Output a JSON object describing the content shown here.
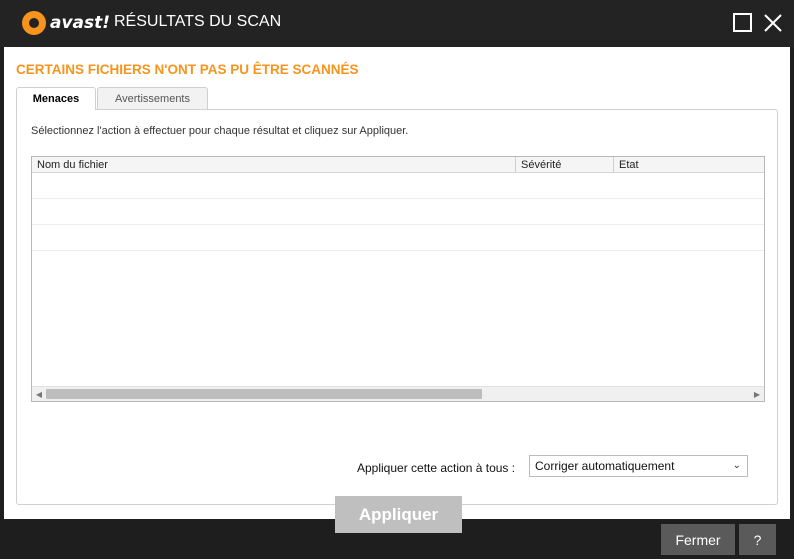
{
  "window": {
    "logo_text": "avast!",
    "title": "RÉSULTATS DU SCAN"
  },
  "main": {
    "heading": "CERTAINS FICHIERS N'ONT PAS PU ÊTRE SCANNÉS",
    "tabs": [
      {
        "label": "Menaces",
        "active": true
      },
      {
        "label": "Avertissements",
        "active": false
      }
    ],
    "instruction": "Sélectionnez l'action à effectuer pour chaque résultat et cliquez sur Appliquer.",
    "table": {
      "columns": [
        "Nom du fichier",
        "Sévérité",
        "Etat"
      ],
      "rows": []
    },
    "apply_all_label": "Appliquer cette action à tous :",
    "action_select": {
      "selected": "Corriger automatiquement"
    },
    "apply_button": "Appliquer"
  },
  "footer": {
    "close_label": "Fermer",
    "help_label": "?"
  },
  "colors": {
    "accent": "#f7941d",
    "titlebar": "#232323",
    "button_disabled": "#bfbfbf",
    "footer_button": "#5a5a5a"
  }
}
